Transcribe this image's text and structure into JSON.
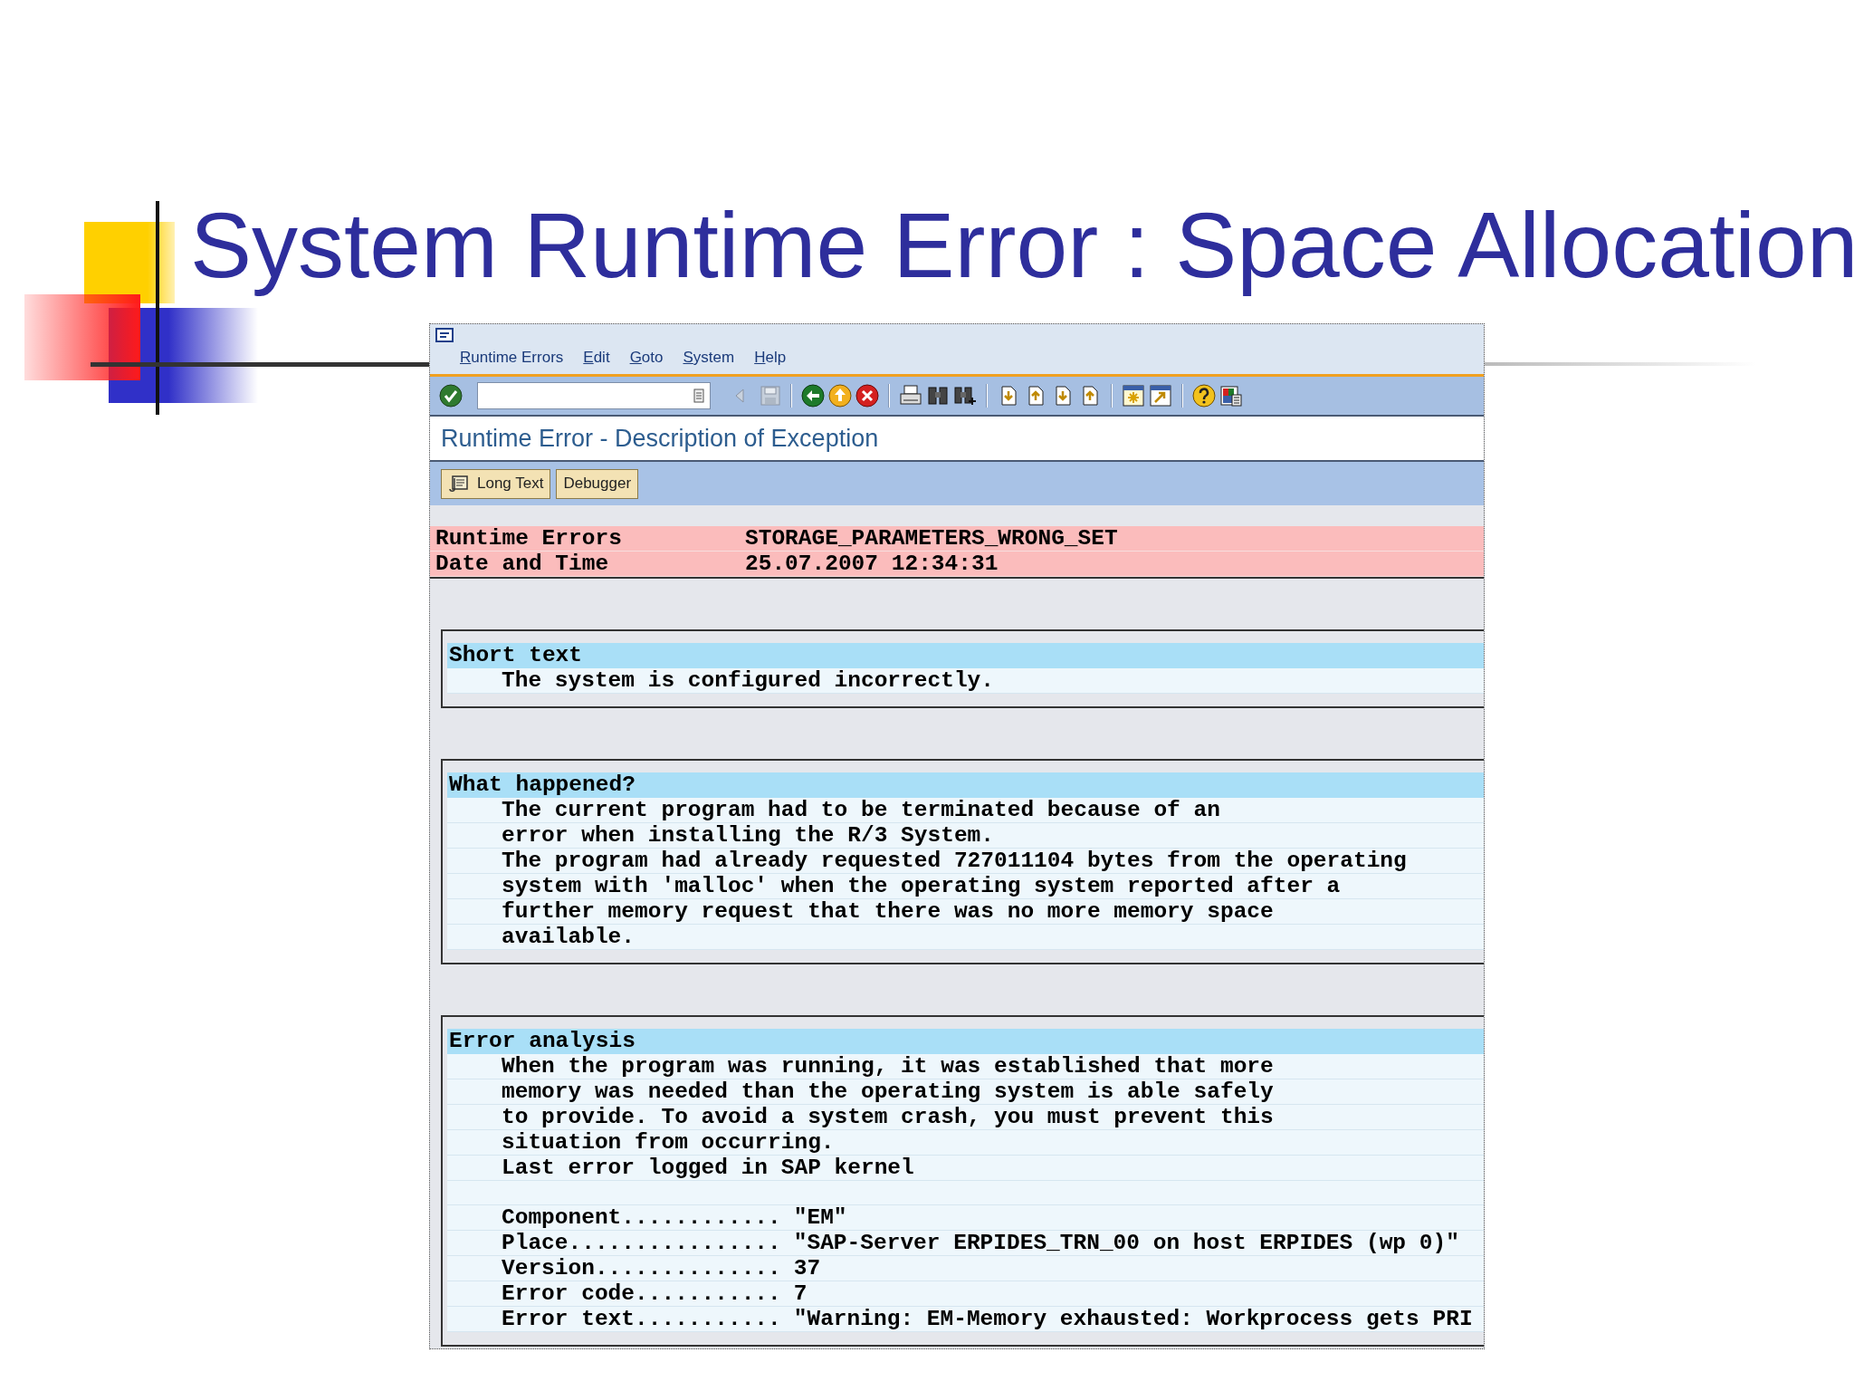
{
  "slide": {
    "title": "System Runtime Error : Space Allocation"
  },
  "menu": [
    {
      "label": "Runtime Errors"
    },
    {
      "label": "Edit"
    },
    {
      "label": "Goto"
    },
    {
      "label": "System"
    },
    {
      "label": "Help"
    }
  ],
  "page_title": "Runtime Error - Description of Exception",
  "app_buttons": [
    {
      "kind": "icon",
      "label": "Long Text"
    },
    {
      "kind": "plain",
      "label": "Debugger"
    }
  ],
  "header_rows": [
    {
      "label": "Runtime Errors",
      "value": "STORAGE_PARAMETERS_WRONG_SET"
    },
    {
      "label": "Date and Time",
      "value": "25.07.2007 12:34:31"
    }
  ],
  "sections": [
    {
      "title": "Short text",
      "lines": [
        "The system is configured incorrectly."
      ]
    },
    {
      "title": "What happened?",
      "lines": [
        "The current program had to be terminated because of an",
        "error when installing the R/3 System.",
        "The program had already requested 727011104 bytes from the operating",
        "system with 'malloc' when the operating system reported after a",
        "further memory request that there was no more memory space",
        "available."
      ]
    },
    {
      "title": "Error analysis",
      "lines": [
        "When the program was running, it was established that more",
        "memory was needed than the operating system is able safely",
        "to provide. To avoid a system crash, you must prevent this",
        "situation from occurring.",
        "Last error logged in SAP kernel"
      ],
      "details": [
        {
          "label": "Component............",
          "value": "\"EM\""
        },
        {
          "label": "Place................",
          "value": "\"SAP-Server ERPIDES_TRN_00 on host ERPIDES (wp 0)\""
        },
        {
          "label": "Version..............",
          "value": "37"
        },
        {
          "label": "Error code...........",
          "value": "7"
        },
        {
          "label": "Error text...........",
          "value": "\"Warning: EM-Memory exhausted: Workprocess gets PRI"
        }
      ]
    }
  ]
}
